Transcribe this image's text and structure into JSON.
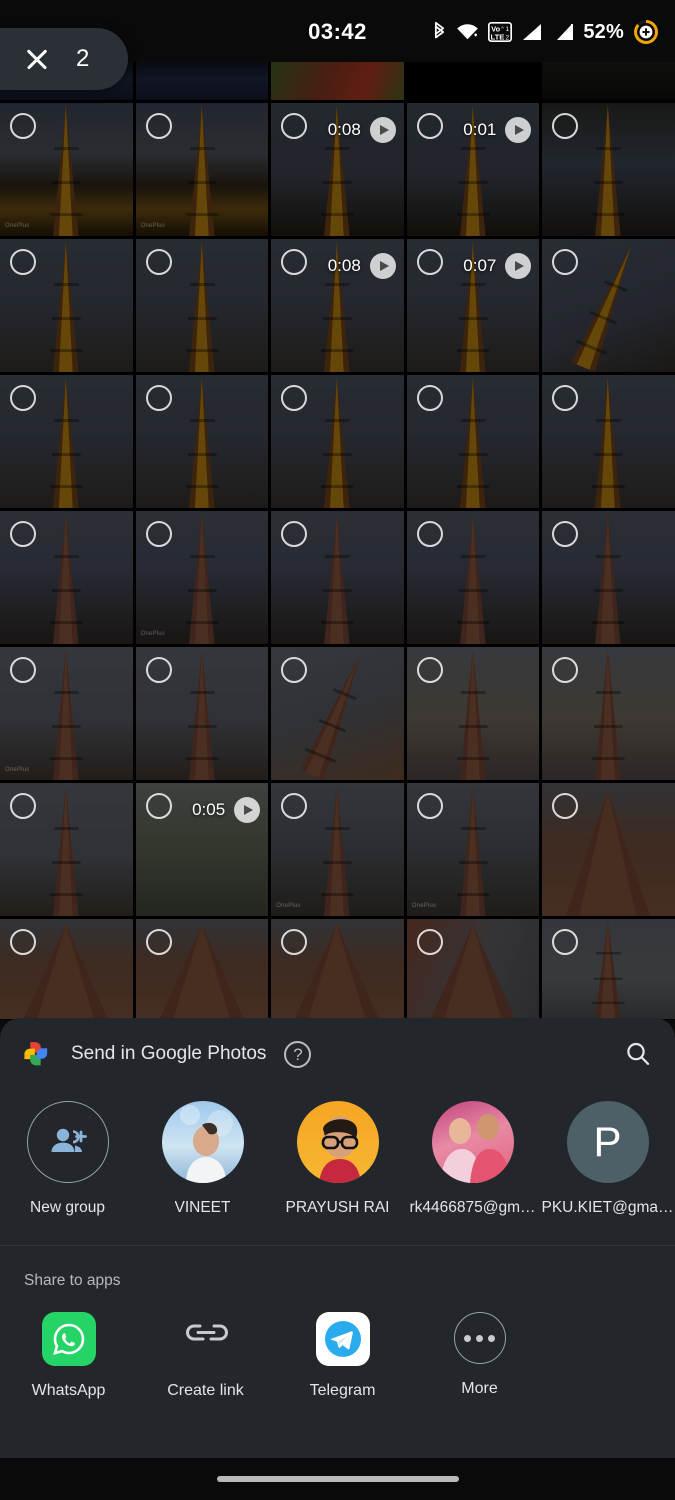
{
  "statusbar": {
    "clock": "03:42",
    "battery": "52%",
    "icons": [
      "bluetooth-icon",
      "wifi-icon",
      "volte-icon",
      "signal-sim1-icon",
      "signal-sim2-icon",
      "battery-charging-icon"
    ],
    "volte_label_top": "Vo 1",
    "volte_label_bottom": "LTE 2"
  },
  "selection": {
    "close_label": "close-icon",
    "count": "2"
  },
  "grid": {
    "columns": 5,
    "rows": [
      {
        "type": "partial-top",
        "cells": [
          {
            "kind": "photo",
            "theme": "curtain",
            "checkbox": false
          },
          {
            "kind": "photo",
            "theme": "curtain",
            "checkbox": false
          },
          {
            "kind": "photo",
            "theme": "flowers",
            "checkbox": false
          },
          {
            "kind": "photo",
            "theme": "black",
            "checkbox": false
          },
          {
            "kind": "photo",
            "theme": "dark",
            "checkbox": false
          }
        ]
      },
      {
        "type": "full",
        "cells": [
          {
            "kind": "photo",
            "theme": "dusk-wide",
            "checkbox": true,
            "watermark": "OnePlus"
          },
          {
            "kind": "photo",
            "theme": "dusk-wide",
            "checkbox": true,
            "watermark": "OnePlus"
          },
          {
            "kind": "video",
            "theme": "dusk-tower",
            "duration": "0:08",
            "checkbox": true
          },
          {
            "kind": "video",
            "theme": "dusk-tower",
            "duration": "0:01",
            "checkbox": true
          },
          {
            "kind": "photo",
            "theme": "arch-tower",
            "checkbox": true
          }
        ]
      },
      {
        "type": "full",
        "cells": [
          {
            "kind": "photo",
            "theme": "lit-tower",
            "checkbox": true
          },
          {
            "kind": "photo",
            "theme": "lit-tower",
            "checkbox": true
          },
          {
            "kind": "video",
            "theme": "lit-tower",
            "duration": "0:08",
            "checkbox": true
          },
          {
            "kind": "video",
            "theme": "lit-tower",
            "duration": "0:07",
            "checkbox": true
          },
          {
            "kind": "photo",
            "theme": "lit-tilt",
            "checkbox": true
          }
        ]
      },
      {
        "type": "full",
        "cells": [
          {
            "kind": "photo",
            "theme": "lit-tower",
            "checkbox": true
          },
          {
            "kind": "photo",
            "theme": "lit-tower",
            "checkbox": true
          },
          {
            "kind": "photo",
            "theme": "lit-tower",
            "checkbox": true
          },
          {
            "kind": "photo",
            "theme": "lit-tower",
            "checkbox": true
          },
          {
            "kind": "photo",
            "theme": "lit-tower",
            "checkbox": true
          }
        ]
      },
      {
        "type": "full",
        "cells": [
          {
            "kind": "photo",
            "theme": "colonnade",
            "checkbox": true
          },
          {
            "kind": "photo",
            "theme": "colonnade",
            "checkbox": true,
            "watermark": "OnePlus"
          },
          {
            "kind": "photo",
            "theme": "colonnade",
            "checkbox": true
          },
          {
            "kind": "photo",
            "theme": "colonnade",
            "checkbox": true
          },
          {
            "kind": "photo",
            "theme": "colonnade",
            "checkbox": true
          }
        ]
      },
      {
        "type": "full",
        "cells": [
          {
            "kind": "photo",
            "theme": "day-tower",
            "checkbox": true,
            "watermark": "OnePlus"
          },
          {
            "kind": "photo",
            "theme": "day-tower",
            "checkbox": true
          },
          {
            "kind": "photo",
            "theme": "day-tilt",
            "checkbox": true
          },
          {
            "kind": "photo",
            "theme": "crowd",
            "checkbox": true
          },
          {
            "kind": "photo",
            "theme": "crowd",
            "checkbox": true
          }
        ]
      },
      {
        "type": "full",
        "cells": [
          {
            "kind": "photo",
            "theme": "day-tower",
            "checkbox": true
          },
          {
            "kind": "video",
            "theme": "ruins-green",
            "duration": "0:05",
            "checkbox": true
          },
          {
            "kind": "photo",
            "theme": "ruins-cols",
            "checkbox": true,
            "watermark": "OnePlus"
          },
          {
            "kind": "photo",
            "theme": "ruins-cols",
            "checkbox": true,
            "watermark": "OnePlus"
          },
          {
            "kind": "photo",
            "theme": "base-flute",
            "checkbox": true
          }
        ]
      },
      {
        "type": "partial-bottom",
        "cells": [
          {
            "kind": "photo",
            "theme": "base-flute",
            "checkbox": true
          },
          {
            "kind": "photo",
            "theme": "base-flute",
            "checkbox": true
          },
          {
            "kind": "photo",
            "theme": "base-flute",
            "checkbox": true
          },
          {
            "kind": "photo",
            "theme": "base-edge",
            "checkbox": true
          },
          {
            "kind": "photo",
            "theme": "crowd-far",
            "checkbox": true
          }
        ]
      }
    ]
  },
  "sheet": {
    "app_logo": "google-photos-logo",
    "title": "Send in Google Photos",
    "help_icon": "help-circle-icon",
    "help_glyph": "?",
    "search_icon": "search-icon",
    "contacts": [
      {
        "name": "New group",
        "avatar": "new-group-icon",
        "type": "action"
      },
      {
        "name": "VINEET",
        "avatar": "contact-photo",
        "type": "person"
      },
      {
        "name": "PRAYUSH RAI",
        "avatar": "contact-photo",
        "type": "person"
      },
      {
        "name": "rk4466875@gm…",
        "avatar": "contact-photo",
        "type": "person"
      },
      {
        "name": "PKU.KIET@gma…",
        "avatar": "letter",
        "type": "person",
        "letter": "P"
      }
    ],
    "apps_section_label": "Share to apps",
    "apps": [
      {
        "name": "WhatsApp",
        "icon": "whatsapp-icon",
        "color": "#25D366"
      },
      {
        "name": "Create link",
        "icon": "link-icon",
        "color": "#c7cbd0"
      },
      {
        "name": "Telegram",
        "icon": "telegram-icon",
        "color": "#2AABEE"
      },
      {
        "name": "More",
        "icon": "more-dots-icon",
        "color": "#c7cbd0"
      }
    ]
  },
  "navbar": {
    "gesture_pill": "home-gesture-pill"
  },
  "colors": {
    "sheet_bg": "#23262b",
    "status_bg": "#0a0a0b",
    "accent_green": "#25D366",
    "accent_blue": "#2AABEE",
    "text_primary": "#e4e5e7",
    "text_secondary": "#b6babf"
  }
}
